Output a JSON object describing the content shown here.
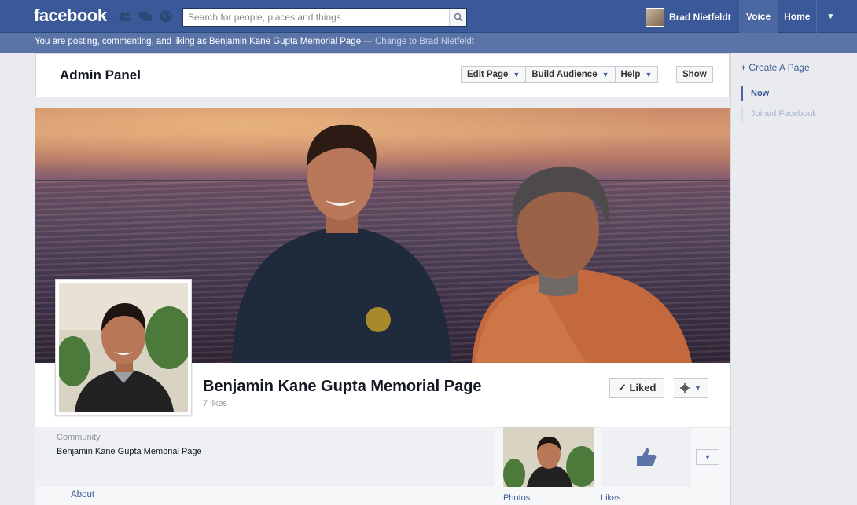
{
  "topbar": {
    "logo": "facebook",
    "search_placeholder": "Search for people, places and things",
    "user_name": "Brad Nietfeldt",
    "nav": [
      "Voice",
      "Home"
    ],
    "colors": {
      "brand": "#3b5998"
    }
  },
  "posting_as": {
    "text": "You are posting, commenting, and liking as Benjamin Kane Gupta Memorial Page — ",
    "link": "Change to Brad Nietfeldt"
  },
  "admin": {
    "title": "Admin Panel",
    "buttons": [
      "Edit Page",
      "Build Audience",
      "Help"
    ],
    "show": "Show"
  },
  "right": {
    "create_page": "+ Create A Page",
    "timeline": [
      "Now",
      "Joined Facebook"
    ]
  },
  "page": {
    "name": "Benjamin Kane Gupta Memorial Page",
    "likes": "7 likes",
    "liked_label": "✓ Liked"
  },
  "info": {
    "category": "Community",
    "about_text": "Benjamin Kane Gupta Memorial Page",
    "about_link": "About",
    "apps": [
      "Photos",
      "Likes"
    ]
  }
}
